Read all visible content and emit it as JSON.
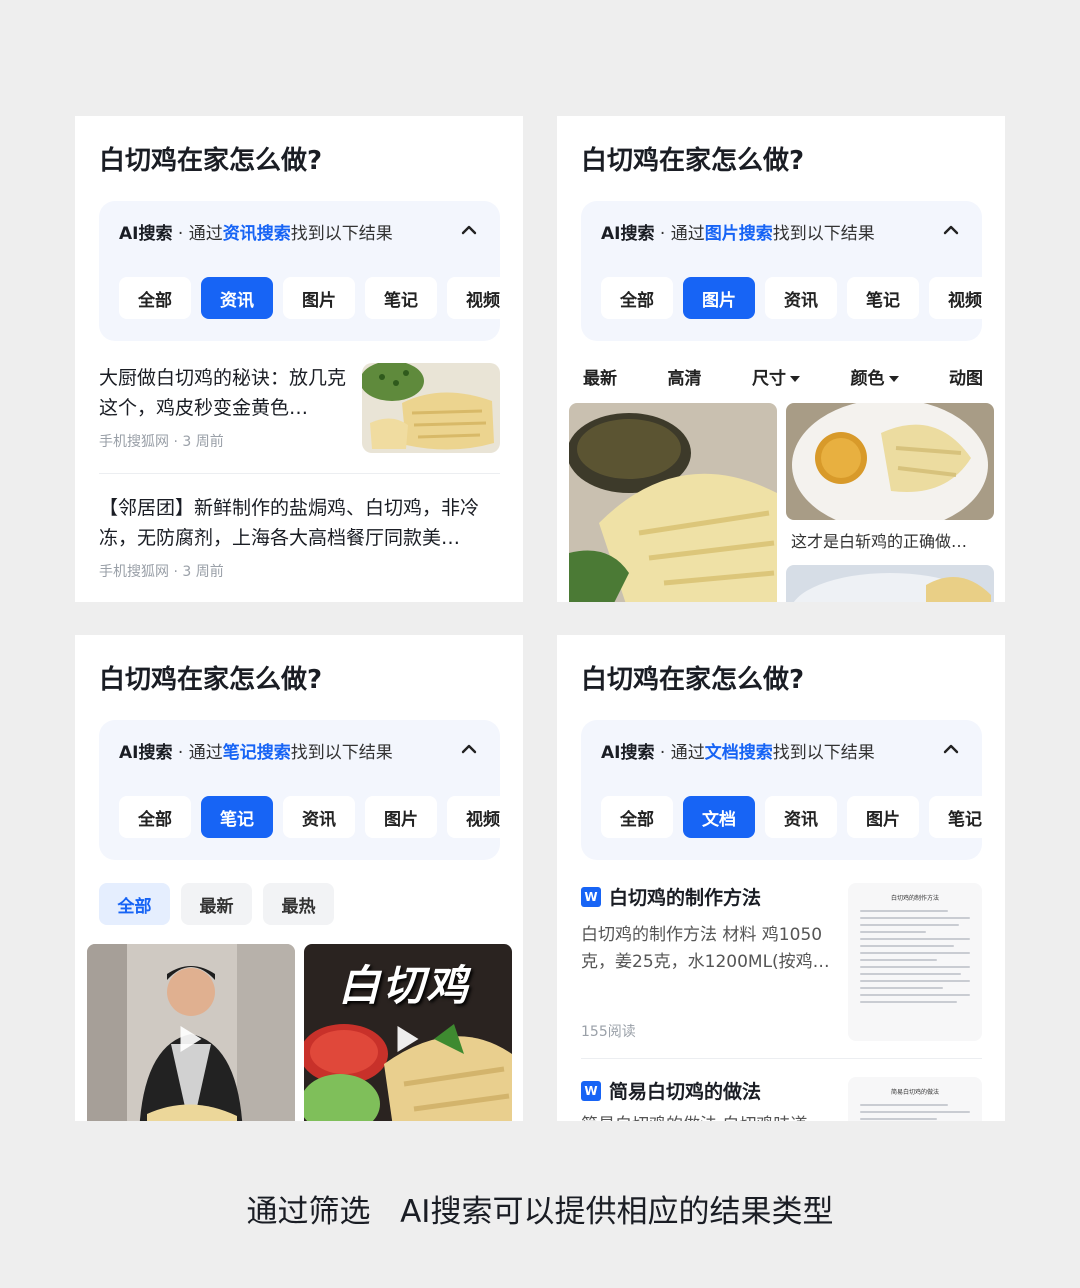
{
  "query": "白切鸡在家怎么做?",
  "ai_label": "AI搜索",
  "ai_prefix": "· 通过",
  "ai_suffix": "找到以下结果",
  "panels": [
    {
      "search_type": "资讯搜索",
      "chips": [
        "全部",
        "资讯",
        "图片",
        "笔记",
        "视频"
      ],
      "active_chip": "资讯",
      "news": [
        {
          "title": "大厨做白切鸡的秘诀：放几克这个，鸡皮秒变金黄色…",
          "source": "手机搜狐网 · 3 周前"
        },
        {
          "title": "【邻居团】新鲜制作的盐焗鸡、白切鸡，非冷冻，无防腐剂，上海各大高档餐厅同款美…",
          "source": "手机搜狐网 · 3 周前"
        }
      ]
    },
    {
      "search_type": "图片搜索",
      "chips": [
        "全部",
        "图片",
        "资讯",
        "笔记",
        "视频"
      ],
      "active_chip": "图片",
      "filters": [
        "最新",
        "高清",
        "尺寸",
        "颜色",
        "动图"
      ],
      "image_caption": "这才是白斩鸡的正确做…"
    },
    {
      "search_type": "笔记搜索",
      "chips": [
        "全部",
        "笔记",
        "资讯",
        "图片",
        "视频"
      ],
      "active_chip": "笔记",
      "sub_tabs": [
        "全部",
        "最新",
        "最热"
      ],
      "active_sub_tab": "全部",
      "video_title_overlay": "白切鸡"
    },
    {
      "search_type": "文档搜索",
      "chips": [
        "全部",
        "文档",
        "资讯",
        "图片",
        "笔记"
      ],
      "active_chip": "文档",
      "docs": [
        {
          "icon": "W",
          "title": "白切鸡的制作方法",
          "summary": "白切鸡的制作方法 材料 鸡1050克，姜25克，水1200ML(按鸡…",
          "reads": "155阅读",
          "thumb_title": "白切鸡的制作方法"
        },
        {
          "icon": "W",
          "title": "简易白切鸡的做法",
          "summary": "简易白切鸡的做法 白切鸡味道…",
          "thumb_title": "简易白切鸡的做法"
        }
      ]
    }
  ],
  "caption": "通过筛选   AI搜索可以提供相应的结果类型",
  "colors": {
    "accent": "#1764f5",
    "panel_bg": "#ffffff",
    "page_bg": "#eeeeee",
    "ai_box_bg": "#f3f6fd"
  }
}
